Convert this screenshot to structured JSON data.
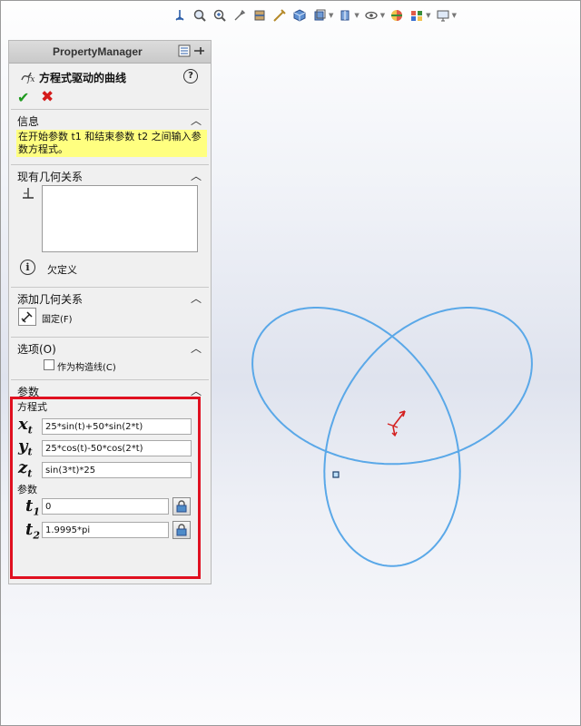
{
  "property_manager": {
    "header_title": "PropertyManager",
    "feature_title": "方程式驱动的曲线",
    "help_label": "?",
    "ok_label": "✔",
    "cancel_label": "✖"
  },
  "sections": {
    "info": {
      "title": "信息",
      "message": "在开始参数 t1 和结束参数 t2 之间输入参数方程式。"
    },
    "existing_relations": {
      "title": "现有几何关系",
      "status": "欠定义"
    },
    "add_relations": {
      "title": "添加几何关系",
      "fix_label": "固定(F)"
    },
    "options": {
      "title": "选项(O)",
      "construction_label": "作为构造线(C)"
    },
    "parameters": {
      "title": "参数",
      "equation_label": "方程式",
      "x_label": "x",
      "y_label": "y",
      "z_label": "z",
      "t_sub": "t",
      "x_value": "25*sin(t)+50*sin(2*t)",
      "y_value": "25*cos(t)-50*cos(2*t)",
      "z_value": "sin(3*t)*25",
      "param_label": "参数",
      "t1_label": "t",
      "t1_sub": "1",
      "t1_value": "0",
      "t2_label": "t",
      "t2_sub": "2",
      "t2_value": "1.9995*pi"
    }
  },
  "colors": {
    "curve": "#5aa8e8",
    "highlight_box": "#e01020",
    "message_bg": "#ffff80",
    "ok": "#1e9a1e",
    "cancel": "#d41a1a"
  }
}
